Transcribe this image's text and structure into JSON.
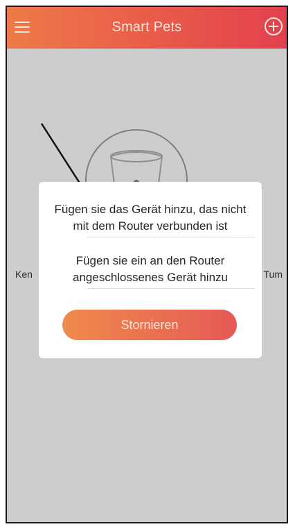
{
  "header": {
    "title": "Smart Pets",
    "menu_icon": "menu-icon",
    "add_icon": "add-circle-icon"
  },
  "background": {
    "left_text": "Ken",
    "right_text": "Tum"
  },
  "dialog": {
    "option_unconnected": "Fügen sie das Gerät hinzu, das nicht mit dem Router verbunden ist",
    "option_connected": "Fügen sie ein an den Router angeschlossenes Gerät hinzu",
    "cancel_label": "Stornieren"
  },
  "colors": {
    "header_gradient_start": "#ee7a48",
    "header_gradient_end": "#e2414f",
    "button_gradient_start": "#f08a4c",
    "button_gradient_end": "#e45a55",
    "overlay": "#cdcdcd",
    "annotation_arrow": "#111111"
  }
}
